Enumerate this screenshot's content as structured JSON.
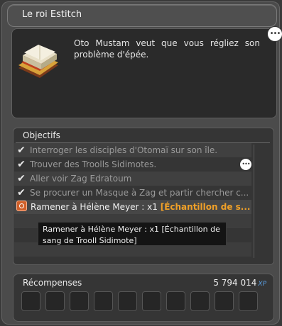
{
  "window": {
    "title": "Le roi Estitch"
  },
  "dialog": {
    "text": "Oto Mustam veut que vous régliez son problème d'épée."
  },
  "objectives": {
    "header": "Objectifs",
    "completed": [
      "Interroger les disciples d'Otomaï sur son île.",
      "Trouver des Troolls Sidimotes.",
      "Aller voir Zag Edratoum",
      "Se procurer un Masque à Zag et partir chercher c..."
    ],
    "current": {
      "text": "Ramener à Hélène Meyer : x1 ",
      "item": "[Échantillon de s..."
    },
    "tooltip": {
      "line1": "Ramener à Hélène Meyer : x1 [Échantillon de",
      "line2": "sang de Trooll Sidimote]"
    }
  },
  "rewards": {
    "label": "Récompenses",
    "xp_value": "5 794 014",
    "xp_unit": "XP",
    "slot_count": 10
  },
  "icons": {
    "check": "check-icon",
    "speech": "speech-bubble-icon",
    "current_objective": "objective-marker-icon",
    "quest": "book-icon"
  }
}
